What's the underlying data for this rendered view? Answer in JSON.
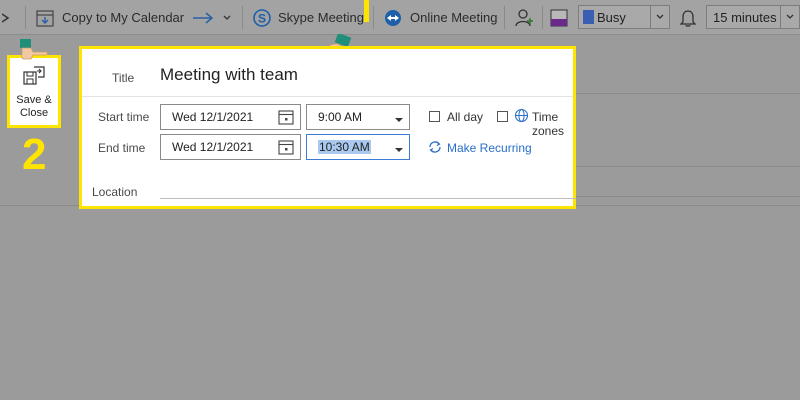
{
  "ribbon": {
    "copy_to_calendar": "Copy to My Calendar",
    "skype_meeting": "Skype Meeting",
    "online_meeting": "Online Meeting",
    "show_as": "Busy",
    "reminder": "15 minutes"
  },
  "save_close": {
    "label_line1": "Save &",
    "label_line2": "Close"
  },
  "step_number": "2",
  "form": {
    "title_label": "Title",
    "title_value": "Meeting with team",
    "start_label": "Start time",
    "start_date": "Wed 12/1/2021",
    "start_time": "9:00 AM",
    "end_label": "End time",
    "end_date": "Wed 12/1/2021",
    "end_time": "10:30 AM",
    "all_day": "All day",
    "time_zones": "Time zones",
    "make_recurring": "Make Recurring",
    "location_label": "Location"
  },
  "colors": {
    "highlight": "#ffe400",
    "link": "#2a6fc9",
    "selection": "#a9c9f0"
  }
}
